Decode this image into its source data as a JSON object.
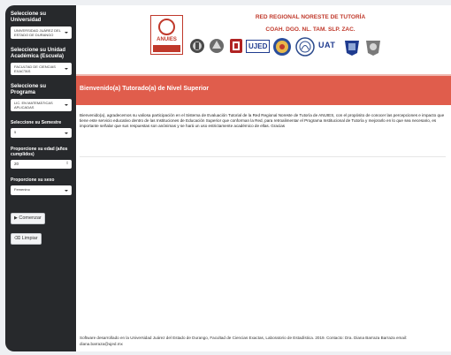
{
  "sidebar": {
    "university_label": "Seleccione su Universidad",
    "university_value": "UNIVERSIDAD JUÁREZ DEL ESTADO DE DURANGO",
    "unit_label": "Seleccione su Unidad Académica (Escuela)",
    "unit_value": "FACULTAD DE CIENCIAS EXACTAS",
    "program_label": "Seleccione su Programa",
    "program_value": "LIC. EN MATEMÁTICAS APLICADAS",
    "semester_label": "Seleccione su Semestre",
    "semester_value": "5",
    "age_label": "Proporcione su edad (años cumplidos)",
    "age_value": "20",
    "sex_label": "Proporcione su sexo",
    "sex_value": "Femenino",
    "start_button": "Comenzar",
    "clear_button": "Limpiar"
  },
  "header": {
    "network_title": "RED REGIONAL NORESTE DE TUTORÍA",
    "network_subtitle": "COAH. DGO. NL. TAM. SLP. ZAC.",
    "anuies_logo_text": "ANUIES",
    "ujed_logo_text": "UJED",
    "uat_logo_text": "UAT"
  },
  "main": {
    "welcome_title": "Bienvenido(a) Tutorado(a) de Nivel Superior",
    "intro_text": "Bienvenido(a), agradecemos su valiosa participación en el Sistema de Evaluación Tutorial de la Red Regional Noreste de Tutoría de ANUIES, con el propósito de conocer las percepciones e impacto que tiene este servicio educativo dentro de las Instituciones de Educación Superior que conforman la Red, para retroalimentar el Programa Institucional de Tutoría y mejorarlo en lo que sea necesario, es importante señalar que sus respuestas son anónimas y se hará un uso estrictamente académico de ellas. Gracias",
    "footer_text": "Software desarrollado en la Universidad Juárez del Estado de Durango, Facultad de Ciencias Exactas, Laboratorio de Estadística. 2019. Contacto: Dra. Diana Barraza Barraza email: diana.barraza@ujed.mx"
  },
  "colors": {
    "sidebar_bg": "#27292c",
    "hero_bg": "#e05d4c",
    "brand_red": "#c0392b"
  }
}
